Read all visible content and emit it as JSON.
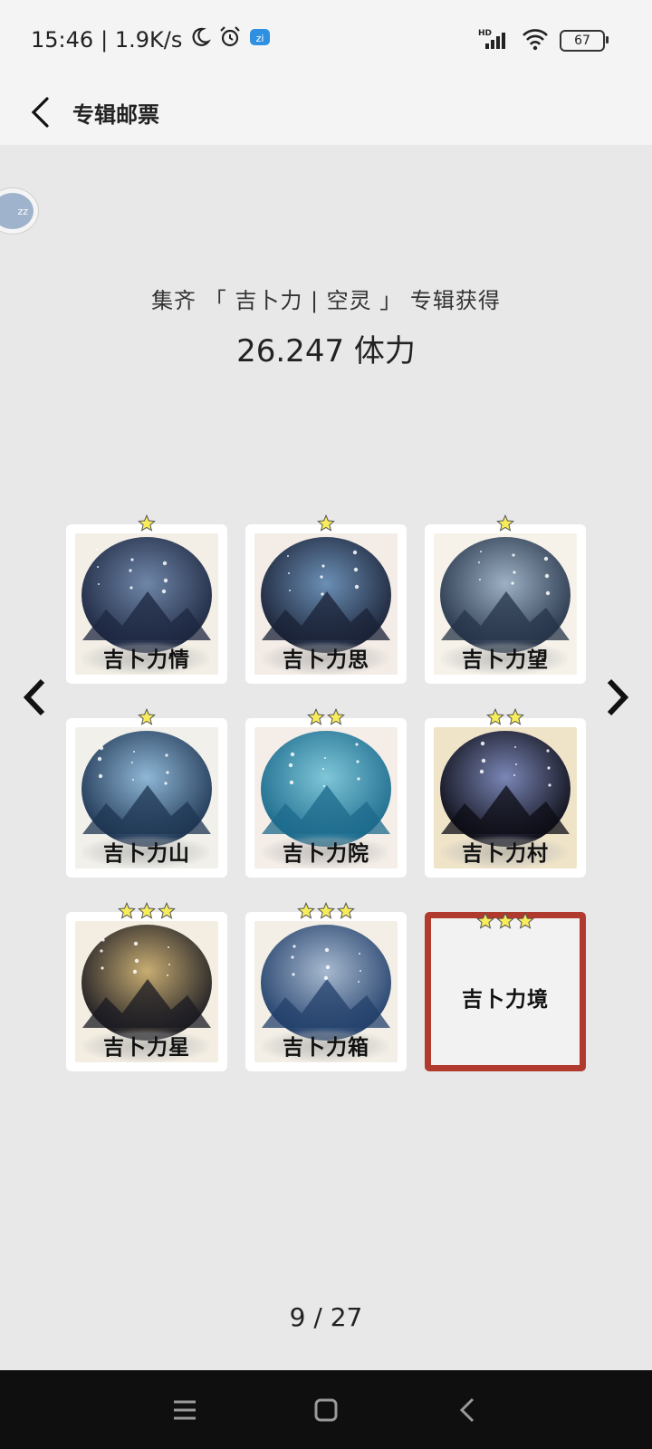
{
  "status_bar": {
    "time": "15:46",
    "network_speed": "| 1.9K/s",
    "battery": "67",
    "icons": [
      "moon-icon",
      "alarm-icon",
      "app-notification-icon",
      "hd-signal-icon",
      "wifi-icon",
      "battery-icon"
    ]
  },
  "header": {
    "title": "专辑邮票"
  },
  "float_bubble": {
    "text": "zz"
  },
  "reward": {
    "line1": "集齐 「 吉卜力 | 空灵 」 专辑获得",
    "line2": "26.247 体力"
  },
  "stamps": [
    {
      "name": "吉卜力情",
      "stars": 1,
      "collected": true,
      "palette": [
        "#1d2740",
        "#6f86a8",
        "#f3efe6"
      ]
    },
    {
      "name": "吉卜力思",
      "stars": 1,
      "collected": true,
      "palette": [
        "#1a2135",
        "#6b8fb5",
        "#f4ece6"
      ]
    },
    {
      "name": "吉卜力望",
      "stars": 1,
      "collected": true,
      "palette": [
        "#263448",
        "#9db0c4",
        "#f6f2ea"
      ]
    },
    {
      "name": "吉卜力山",
      "stars": 1,
      "collected": true,
      "palette": [
        "#1e3552",
        "#8fb7d6",
        "#f1f0ea"
      ]
    },
    {
      "name": "吉卜力院",
      "stars": 2,
      "collected": true,
      "palette": [
        "#1c6a8c",
        "#7fc6d8",
        "#f5eee8"
      ]
    },
    {
      "name": "吉卜力村",
      "stars": 2,
      "collected": true,
      "palette": [
        "#0c0c14",
        "#7a86b6",
        "#f0e4c8"
      ]
    },
    {
      "name": "吉卜力星",
      "stars": 3,
      "collected": true,
      "palette": [
        "#1a1a22",
        "#c8ad72",
        "#f4eee2"
      ]
    },
    {
      "name": "吉卜力箱",
      "stars": 3,
      "collected": true,
      "palette": [
        "#23406b",
        "#a7b9cf",
        "#f3efe6"
      ]
    },
    {
      "name": "吉卜力境",
      "stars": 3,
      "collected": false,
      "palette": [
        "#f2f2f2",
        "#f2f2f2",
        "#f2f2f2"
      ]
    }
  ],
  "colors": {
    "locked_border": "#b03a2e",
    "star_fill": "#f7ec5a",
    "background": "#e8e8e8"
  },
  "pager": {
    "text": "9 / 27"
  },
  "navigation": {
    "prev": "chevron-left-icon",
    "next": "chevron-right-icon",
    "system": [
      "menu-icon",
      "home-icon",
      "back-icon"
    ]
  }
}
